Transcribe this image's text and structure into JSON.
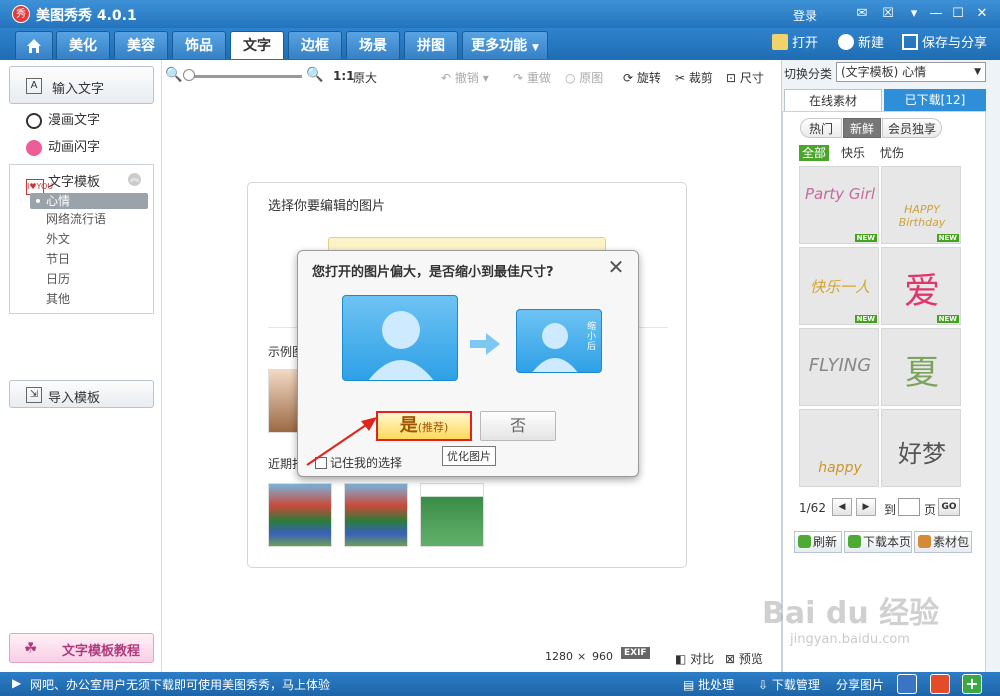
{
  "app": {
    "title": "美图秀秀 4.0.1",
    "logo_char": "秀"
  },
  "titlebar": {
    "login": "登录"
  },
  "menu": {
    "tabs": [
      "美化",
      "美容",
      "饰品",
      "文字",
      "边框",
      "场景",
      "拼图",
      "更多功能"
    ],
    "active": "文字",
    "actions": {
      "open": "打开",
      "new": "新建",
      "save": "保存与分享"
    }
  },
  "left": {
    "input_text": "输入文字",
    "comic_text": "漫画文字",
    "flash_text": "动画闪字",
    "template_header": "文字模板",
    "template_icon_text": "I♥YOU",
    "subitems": [
      "心情",
      "网络流行语",
      "外文",
      "节日",
      "日历",
      "其他"
    ],
    "active_subitem": "心情",
    "import_template": "导入模板",
    "tutorial": "文字模板教程"
  },
  "toolbar": {
    "zoom_label": "1:1",
    "original_size": "原大",
    "undo": "撤销",
    "redo": "重做",
    "original": "原图",
    "rotate": "旋转",
    "crop": "裁剪",
    "resize": "尺寸"
  },
  "canvas": {
    "select_title": "选择你要编辑的图片",
    "example_label": "示例图",
    "recent_label": "近期打",
    "img_width": "1280",
    "x": "×",
    "img_height": "960",
    "exif": "EXIF",
    "compare": "对比",
    "preview": "预览"
  },
  "modal": {
    "title": "您打开的图片偏大，是否缩小到最佳尺寸?",
    "yes": "是",
    "yes_note": "(推荐)",
    "no": "否",
    "tooltip": "优化图片",
    "remember": "记住我的选择",
    "small_label": "缩小后"
  },
  "right": {
    "switch_label": "切换分类",
    "switch_value": "(文字模板) 心情",
    "tab_online": "在线素材",
    "tab_downloaded": "已下载[12]",
    "pills": [
      "热门",
      "新鲜",
      "会员独享"
    ],
    "active_pill": "新鲜",
    "filters": [
      "全部",
      "快乐",
      "忧伤"
    ],
    "active_filter": "全部",
    "items": [
      {
        "art": "Party Girl",
        "badge": "NEW"
      },
      {
        "art": "HAPPY Birthday",
        "badge": "NEW"
      },
      {
        "art": "快乐一人",
        "badge": "NEW"
      },
      {
        "art": "爱",
        "badge": "NEW"
      },
      {
        "art": "FLYING",
        "badge": ""
      },
      {
        "art": "夏",
        "badge": ""
      },
      {
        "art": "happy",
        "badge": ""
      },
      {
        "art": "好梦",
        "badge": ""
      }
    ],
    "page_status": "1/62",
    "goto_label": "到",
    "page_unit": "页",
    "go": "GO",
    "refresh": "刷新",
    "download_page": "下载本页",
    "material_pack": "素材包"
  },
  "statusbar": {
    "message": "网吧、办公室用户无须下载即可使用美图秀秀，马上体验",
    "batch": "批处理",
    "download_mgr": "下载管理",
    "share_img": "分享图片"
  },
  "watermark": {
    "main": "Bai du 经验",
    "sub": "jingyan.baidu.com"
  }
}
